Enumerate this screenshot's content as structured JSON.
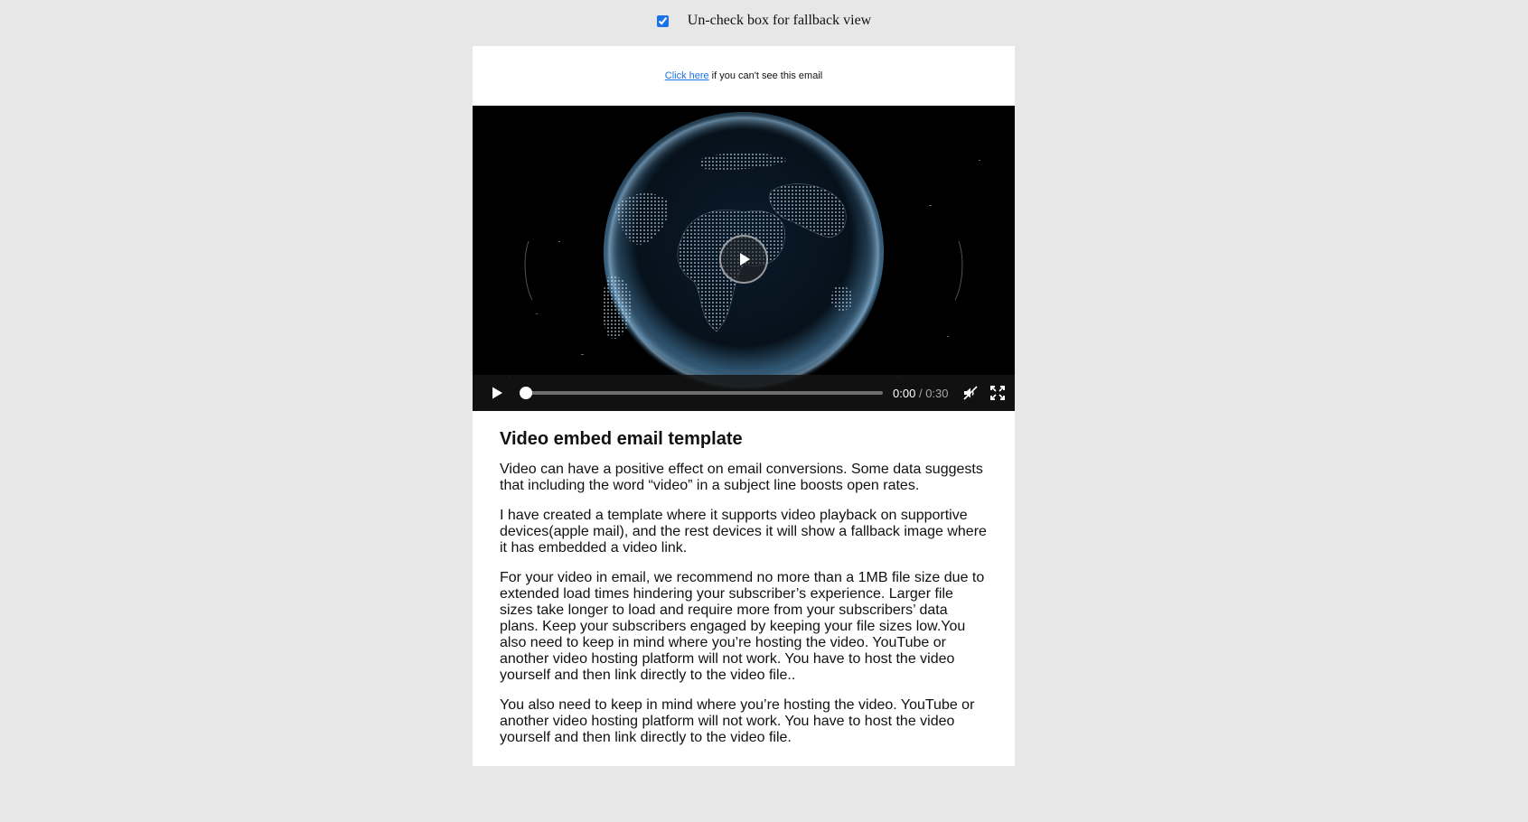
{
  "toggle": {
    "checked": true,
    "label": "Un-check box for fallback view"
  },
  "preheader": {
    "link_text": "Click here",
    "text": "if you can't see this email"
  },
  "video": {
    "current_time": "0:00",
    "separator": "/",
    "duration": "0:30",
    "progress": 0,
    "icons": {
      "big_play": "play-icon",
      "play": "play-icon",
      "mute": "muted-speaker-icon",
      "fullscreen": "fullscreen-icon"
    }
  },
  "article": {
    "heading": "Video embed email template",
    "paragraphs": [
      "Video can have a positive effect on email conversions. Some data suggests that including the word “video” in a subject line boosts open rates.",
      "I have created a template where it supports video playback on supportive devices(apple mail), and the rest devices it will show a fallback image where it has embedded a video link.",
      "For your video in email, we recommend no more than a 1MB file size due to extended load times hindering your subscriber’s experience. Larger file sizes take longer to load and require more from your subscribers’ data plans. Keep your subscribers engaged by keeping your file sizes low.You also need to keep in mind where you’re hosting the video. YouTube or another video hosting platform will not work. You have to host the video yourself and then link directly to the video file..",
      "You also need to keep in mind where you’re hosting the video. YouTube or another video hosting platform will not work. You have to host the video yourself and then link directly to the video file."
    ]
  },
  "colors": {
    "page_background": "#e7e7e7",
    "card_background": "#ffffff",
    "link": "#1a73e8",
    "player_background": "#000000"
  }
}
